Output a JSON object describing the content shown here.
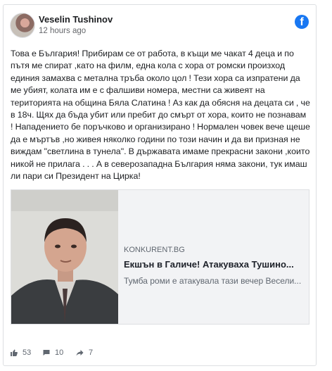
{
  "post": {
    "author": "Veselin Tushinov",
    "time": "12 hours ago",
    "platform_icon": "facebook-icon",
    "text": "Това е България! Прибирам се от работа, в къщи ме чакат 4 деца и по пътя ме спират ,като на филм, една кола с хора от ромски произход единия замахва с метална тръба около цол ! Тези хора са изпратени да ме убият, колата им е с фалшиви номера, местни са живеят на територията на община Бяла Слатина ! Аз как да обясня на децата си , че в 18ч. Щях да бъда убит или пребит до смърт от хора, които не познавам ! Нападението бе поръчково и организирано ! Нормален човек вече щеше да е мъртъв ,но живея няколко години по този начин и да ви призная не виждам \"светлина в тунела\". В държавата имаме прекрасни закони ,които никой не прилага . . . А в северозападна България няма закони, тук имаш ли пари си Президент на Цирка!"
  },
  "link": {
    "domain": "KONKURENT.BG",
    "title": "Екшън в Галиче! Атакуваха Тушино...",
    "description": "Тумба роми е атакувала тази вечер Весели..."
  },
  "stats": {
    "likes": "53",
    "comments": "10",
    "shares": "7"
  },
  "colors": {
    "facebook_blue": "#1877f2",
    "text": "#1c1e21",
    "meta": "#65676b"
  }
}
